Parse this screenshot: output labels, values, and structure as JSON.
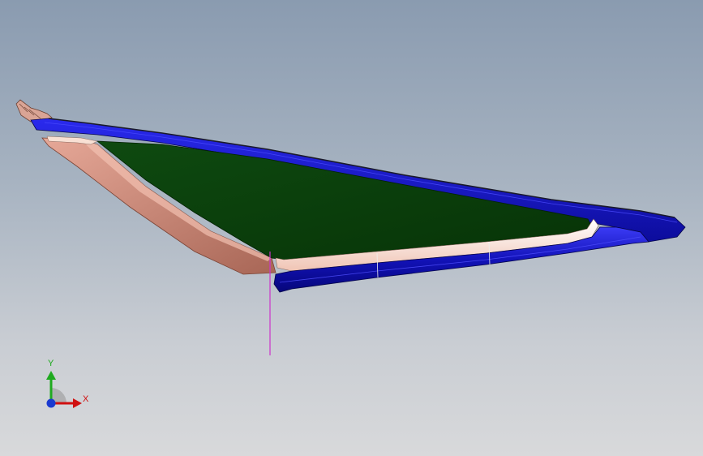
{
  "viewport": {
    "background_top": "#8a9bb0",
    "background_bottom": "#d8d9db"
  },
  "model": {
    "parts": [
      {
        "name": "top-face",
        "color": "#0a3a0a"
      },
      {
        "name": "outer-rim",
        "color": "#1a1acc"
      },
      {
        "name": "side-wall",
        "color": "#c88a7c"
      },
      {
        "name": "inner-fillet",
        "color": "#f4d4c8"
      }
    ],
    "sketch_line_color": "#cc33cc"
  },
  "triad": {
    "x_label": "X",
    "y_label": "Y",
    "x_color": "#d01010",
    "y_color": "#1faa1f",
    "z_color": "#1a3ad0"
  }
}
